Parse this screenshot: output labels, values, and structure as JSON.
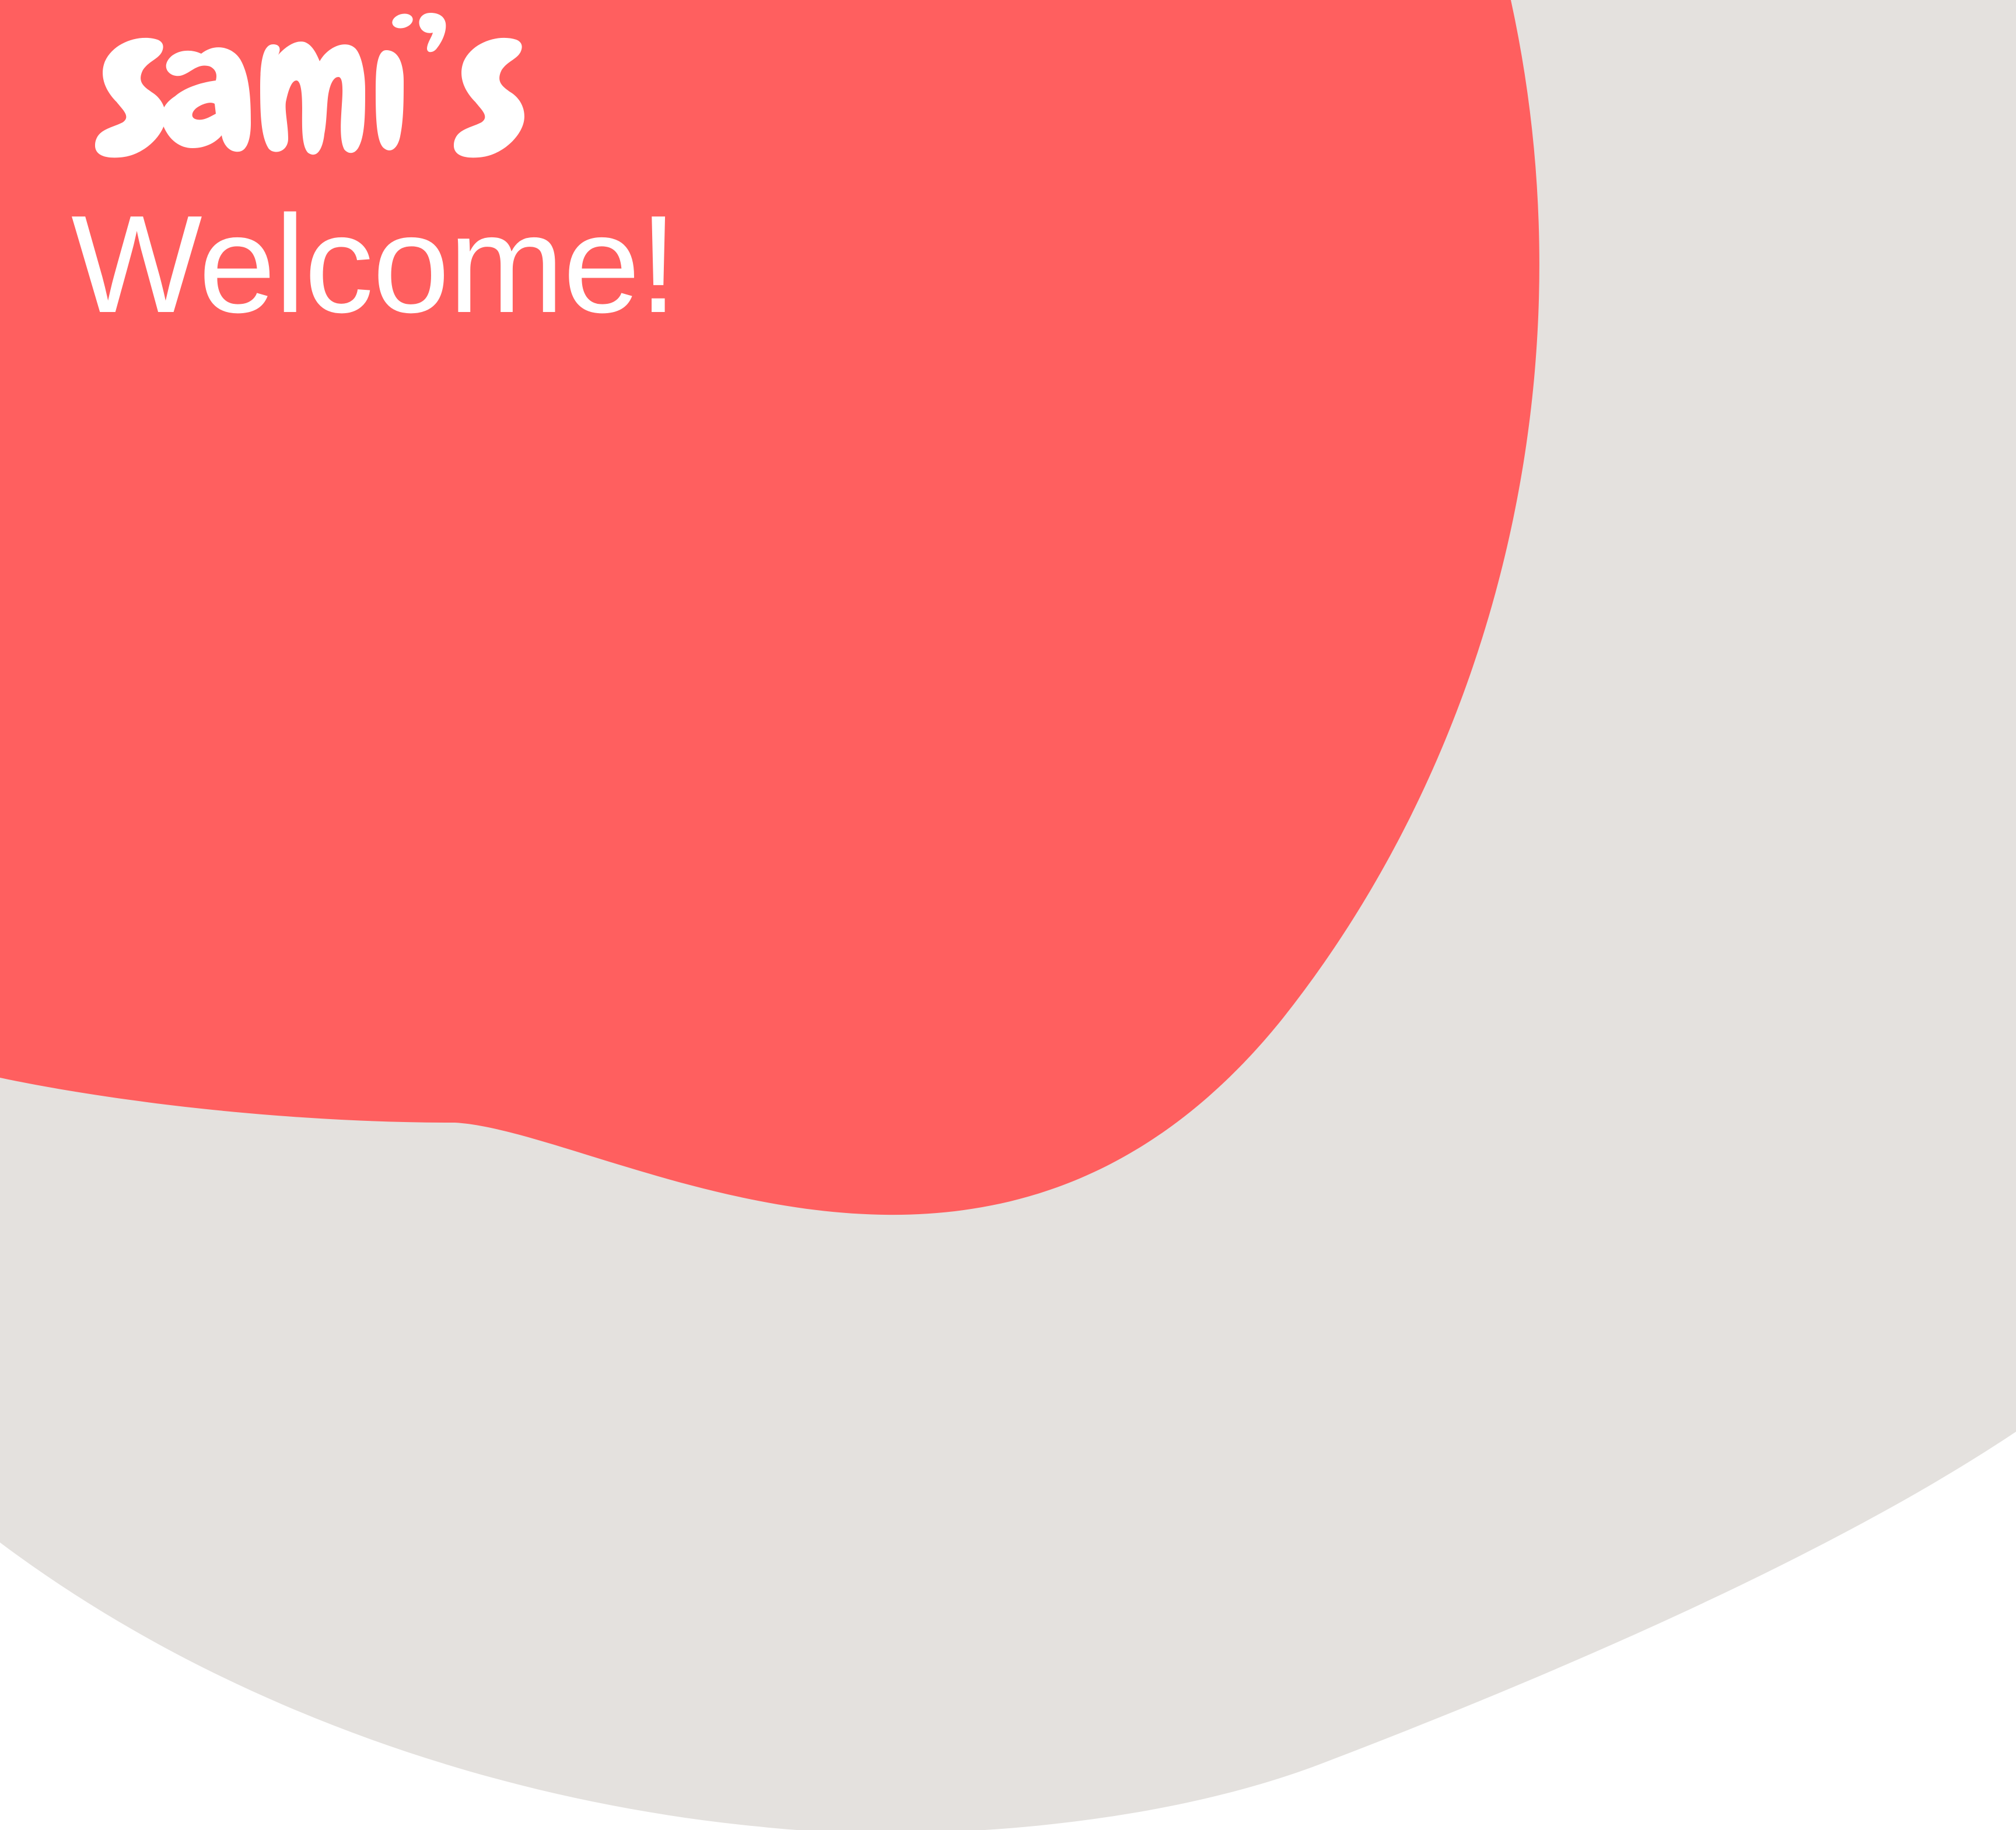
{
  "brand": {
    "logo_text": "sami's",
    "logo_icon": "sami-s-wordmark"
  },
  "hero": {
    "heading": "Welcome!"
  },
  "colors": {
    "page_background": "#ffffff",
    "beige_blob": "#e4e1de",
    "coral_blob": "#ff5f5f",
    "text": "#ffffff"
  }
}
